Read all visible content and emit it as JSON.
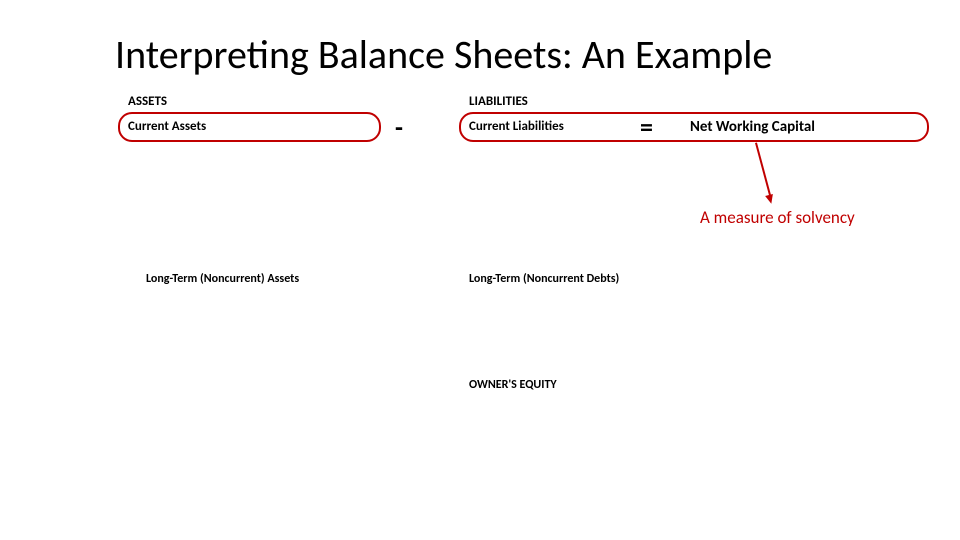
{
  "title": "Interpreting Balance Sheets: An Example",
  "assets": {
    "heading": "ASSETS",
    "current": "Current Assets",
    "longterm": "Long-Term (Noncurrent) Assets"
  },
  "liabilities": {
    "heading": "LIABILITIES",
    "current": "Current Liabilities",
    "longterm": "Long-Term (Noncurrent Debts)"
  },
  "equity": {
    "heading": "OWNER'S EQUITY"
  },
  "operators": {
    "minus": "-",
    "equals": "="
  },
  "result": "Net Working Capital",
  "annotation": "A measure of solvency"
}
